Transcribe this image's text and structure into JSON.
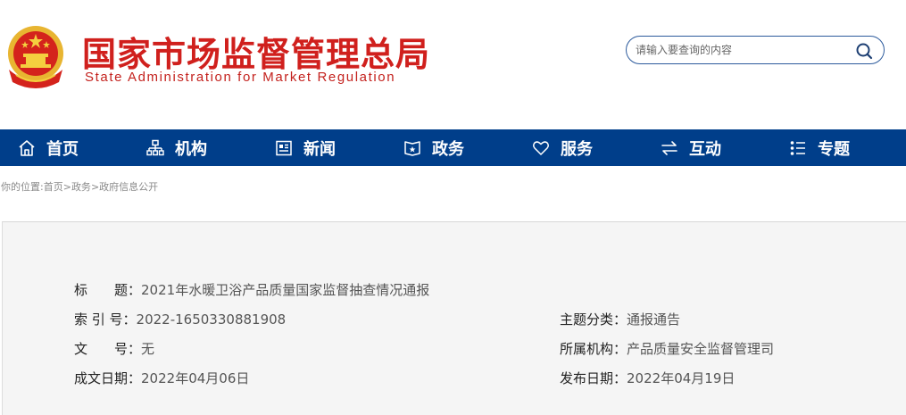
{
  "header": {
    "title_cn": "国家市场监督管理总局",
    "title_en": "State Administration for Market Regulation",
    "search_placeholder": "请输入要查询的内容"
  },
  "nav": {
    "items": [
      {
        "label": "首页",
        "icon": "home-icon"
      },
      {
        "label": "机构",
        "icon": "org-chart-icon"
      },
      {
        "label": "新闻",
        "icon": "news-icon"
      },
      {
        "label": "政务",
        "icon": "government-affairs-icon"
      },
      {
        "label": "服务",
        "icon": "heart-icon"
      },
      {
        "label": "互动",
        "icon": "exchange-arrows-icon"
      },
      {
        "label": "专题",
        "icon": "topics-list-icon"
      }
    ]
  },
  "breadcrumb": {
    "prefix": "你的位置:",
    "items": [
      "首页",
      "政务",
      "政府信息公开"
    ],
    "separator": ">"
  },
  "info": {
    "title_label": "标　　题：",
    "title_value": "2021年水暖卫浴产品质量国家监督抽查情况通报",
    "index_label": "索 引 号：",
    "index_value": "2022-1650330881908",
    "doc_label": "文　　号：",
    "doc_value": "无",
    "created_label": "成文日期：",
    "created_value": "2022年04月06日",
    "category_label": "主题分类：",
    "category_value": "通报通告",
    "org_label": "所属机构：",
    "org_value": "产品质量安全监督管理司",
    "published_label": "发布日期：",
    "published_value": "2022年04月19日"
  },
  "colors": {
    "brand_red": "#d0201d",
    "nav_blue": "#003e8a",
    "panel_bg": "#f5f5f5"
  }
}
